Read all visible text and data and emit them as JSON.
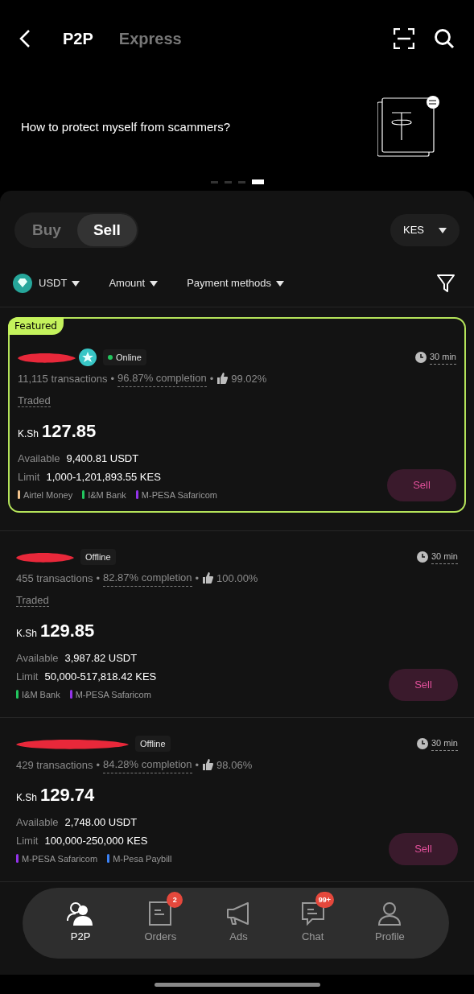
{
  "header": {
    "tabs": [
      {
        "label": "P2P",
        "selected": true
      },
      {
        "label": "Express",
        "selected": false
      }
    ]
  },
  "banner": {
    "text": "How to protect myself from scammers?",
    "pages": [
      {
        "selected": false
      },
      {
        "selected": false
      },
      {
        "selected": false
      },
      {
        "selected": true
      }
    ]
  },
  "side_toggle": [
    {
      "label": "Buy",
      "selected": false
    },
    {
      "label": "Sell",
      "selected": true
    }
  ],
  "currency": "KES",
  "filters": [
    {
      "label": "USDT",
      "kind": "coin"
    },
    {
      "label": "Amount",
      "kind": "plain"
    },
    {
      "label": "Payment methods",
      "kind": "plain"
    }
  ],
  "listings": [
    {
      "featured_label": "Featured",
      "verified": true,
      "status": "Online",
      "online": true,
      "time": "30 min",
      "transactions": "11,115 transactions",
      "completion": "96.87% completion",
      "rating": "99.02%",
      "traded": "Traded",
      "currency_symbol": "K.Sh",
      "price": "127.85",
      "available_label": "Available",
      "available": "9,400.81 USDT",
      "limit_label": "Limit",
      "limit": "1,000-1,201,893.55 KES",
      "methods": [
        {
          "name": "Airtel Money",
          "color": "#f2c48d"
        },
        {
          "name": "I&M Bank",
          "color": "#22c55e"
        },
        {
          "name": "M-PESA Safaricom",
          "color": "#9333ea"
        }
      ],
      "action": "Sell"
    },
    {
      "verified": false,
      "status": "Offline",
      "online": false,
      "time": "30 min",
      "transactions": "455 transactions",
      "completion": "82.87% completion",
      "rating": "100.00%",
      "traded": "Traded",
      "currency_symbol": "K.Sh",
      "price": "129.85",
      "available_label": "Available",
      "available": "3,987.82 USDT",
      "limit_label": "Limit",
      "limit": "50,000-517,818.42 KES",
      "methods": [
        {
          "name": "I&M Bank",
          "color": "#22c55e"
        },
        {
          "name": "M-PESA Safaricom",
          "color": "#9333ea"
        }
      ],
      "action": "Sell"
    },
    {
      "verified": false,
      "status": "Offline",
      "online": false,
      "time": "30 min",
      "transactions": "429 transactions",
      "completion": "84.28% completion",
      "rating": "98.06%",
      "currency_symbol": "K.Sh",
      "price": "129.74",
      "available_label": "Available",
      "available": "2,748.00 USDT",
      "limit_label": "Limit",
      "limit": "100,000-250,000 KES",
      "methods": [
        {
          "name": "M-PESA Safaricom",
          "color": "#9333ea"
        },
        {
          "name": "M-Pesa Paybill",
          "color": "#3b82f6"
        }
      ],
      "action": "Sell"
    }
  ],
  "separator": "•",
  "bottom_nav": [
    {
      "label": "P2P",
      "kind": "p2p",
      "selected": true
    },
    {
      "label": "Orders",
      "kind": "orders",
      "selected": false,
      "badge": "2"
    },
    {
      "label": "Ads",
      "kind": "ads",
      "selected": false
    },
    {
      "label": "Chat",
      "kind": "chat",
      "selected": false,
      "badge": "99+"
    },
    {
      "label": "Profile",
      "kind": "profile",
      "selected": false
    }
  ]
}
